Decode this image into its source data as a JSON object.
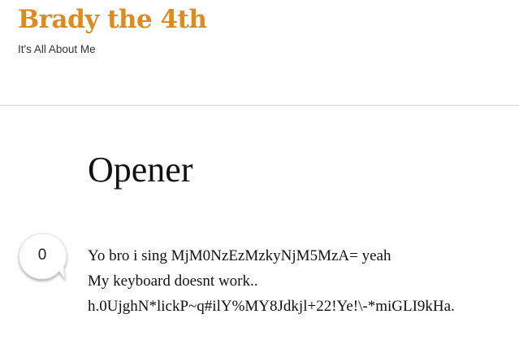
{
  "site": {
    "title": "Brady the 4th",
    "tagline": "It's All About Me"
  },
  "post": {
    "title": "Opener",
    "comment_count": "0",
    "lines": [
      "Yo bro i sing MjM0NzEzMzkyNjM5MzA= yeah",
      "My keyboard doesnt work..",
      "h.0UjghN*lickP~q#ilY%MY8Jdkjl+22!Ye!\\-*miGLI9kHa."
    ]
  },
  "colors": {
    "site_title": "#dd8a1e",
    "divider": "#d8d8d8",
    "text": "#111111"
  },
  "icons": {
    "comment_bubble": "speech-bubble-icon"
  }
}
